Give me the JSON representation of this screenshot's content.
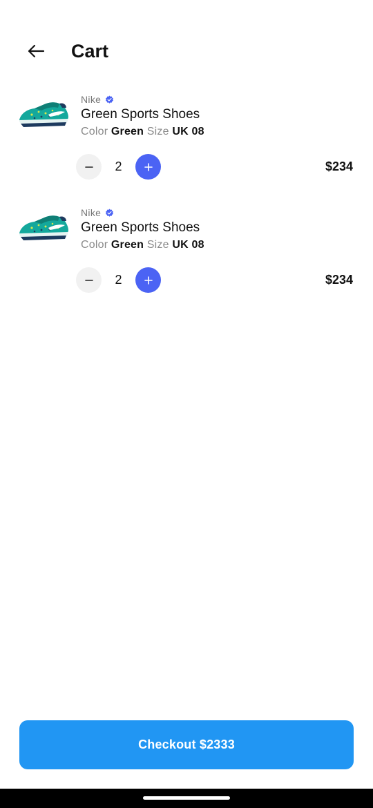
{
  "header": {
    "back_icon": "arrow-left-icon",
    "title": "Cart"
  },
  "cart": {
    "items": [
      {
        "brand": "Nike",
        "verified_icon": "verified-badge-icon",
        "name": "Green Sports Shoes",
        "color_label": "Color",
        "color_value": "Green",
        "size_label": "Size",
        "size_value": "UK 08",
        "quantity": "2",
        "price": "$234"
      },
      {
        "brand": "Nike",
        "verified_icon": "verified-badge-icon",
        "name": "Green Sports Shoes",
        "color_label": "Color",
        "color_value": "Green",
        "size_label": "Size",
        "size_value": "UK 08",
        "quantity": "2",
        "price": "$234"
      }
    ]
  },
  "checkout": {
    "label": "Checkout $2333"
  },
  "colors": {
    "accent": "#4b63f4",
    "checkout": "#2196f3",
    "muted": "#8a8a8a"
  }
}
